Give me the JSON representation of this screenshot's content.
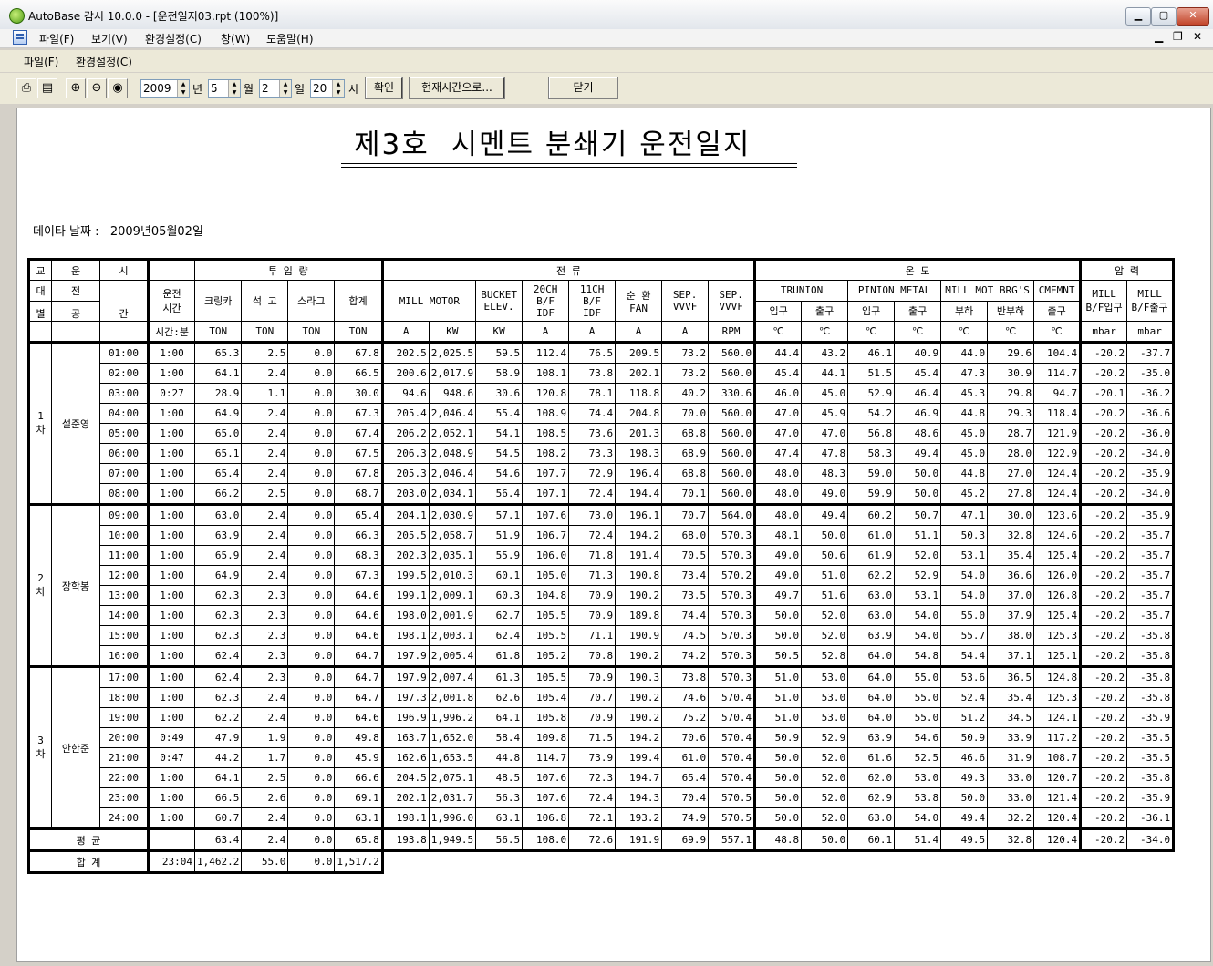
{
  "window": {
    "title": "AutoBase 감시 10.0.0 - [운전일지03.rpt (100%)]"
  },
  "menu_main": [
    "파일(F)",
    "보기(V)",
    "환경설정(C)",
    "창(W)",
    "도움말(H)"
  ],
  "menu_report": [
    "파일(F)",
    "환경설정(C)"
  ],
  "toolbar": {
    "year": "2009",
    "year_unit": "년",
    "month": "5",
    "month_unit": "월",
    "day": "2",
    "day_unit": "일",
    "hour": "20",
    "hour_unit": "시",
    "confirm": "확인",
    "current_time": "현재시간으로...",
    "close": "닫기"
  },
  "report": {
    "title": "제3호  시멘트 분쇄기 운전일지",
    "date_label": "데이타 날짜 :",
    "date_value": "2009년05월02일"
  },
  "headers": {
    "shift": [
      "교",
      "대",
      "별"
    ],
    "operator": [
      "운",
      "전",
      "공"
    ],
    "time": [
      "시",
      "간"
    ],
    "run_time": "운전\n시간",
    "input": "투 입 량",
    "current": "전 류",
    "temp": "온 도",
    "pressure": "압 력",
    "clinker": "크링카",
    "gypsum": "석 고",
    "slag": "스라그",
    "total": "합계",
    "mill_motor": "MILL MOTOR",
    "bucket": "BUCKET\nELEV.",
    "ch20": "20CH\nB/F IDF",
    "ch11": "11CH\nB/F IDF",
    "circ_fan": "순 환\nFAN",
    "sep_vvvf_a": "SEP.\nVVVF",
    "sep_vvvf_rpm": "SEP.\nVVVF",
    "trunion": "TRUNION",
    "pinion": "PINION METAL",
    "mill_brg": "MILL MOT BRG'S",
    "cmemnt": "CMEMNT",
    "mill_in": "MILL\nB/F입구",
    "mill_out": "MILL\nB/F출구",
    "sub_in": "입구",
    "sub_out": "출구",
    "sub_load": "부하",
    "sub_anti": "반부하",
    "units": [
      "시간:분",
      "TON",
      "TON",
      "TON",
      "TON",
      "A",
      "KW",
      "KW",
      "A",
      "A",
      "A",
      "A",
      "RPM",
      "℃",
      "℃",
      "℃",
      "℃",
      "℃",
      "℃",
      "℃",
      "mbar",
      "mbar"
    ]
  },
  "shifts": [
    {
      "shift": "1\n차",
      "operator": "설준영",
      "rows": [
        [
          "01:00",
          "1:00",
          "65.3",
          "2.5",
          "0.0",
          "67.8",
          "202.5",
          "2,025.5",
          "59.5",
          "112.4",
          "76.5",
          "209.5",
          "73.2",
          "560.0",
          "44.4",
          "43.2",
          "46.1",
          "40.9",
          "44.0",
          "29.6",
          "104.4",
          "-20.2",
          "-37.7"
        ],
        [
          "02:00",
          "1:00",
          "64.1",
          "2.4",
          "0.0",
          "66.5",
          "200.6",
          "2,017.9",
          "58.9",
          "108.1",
          "73.8",
          "202.1",
          "73.2",
          "560.0",
          "45.4",
          "44.1",
          "51.5",
          "45.4",
          "47.3",
          "30.9",
          "114.7",
          "-20.2",
          "-35.0"
        ],
        [
          "03:00",
          "0:27",
          "28.9",
          "1.1",
          "0.0",
          "30.0",
          "94.6",
          "948.6",
          "30.6",
          "120.8",
          "78.1",
          "118.8",
          "40.2",
          "330.6",
          "46.0",
          "45.0",
          "52.9",
          "46.4",
          "45.3",
          "29.8",
          "94.7",
          "-20.1",
          "-36.2"
        ],
        [
          "04:00",
          "1:00",
          "64.9",
          "2.4",
          "0.0",
          "67.3",
          "205.4",
          "2,046.4",
          "55.4",
          "108.9",
          "74.4",
          "204.8",
          "70.0",
          "560.0",
          "47.0",
          "45.9",
          "54.2",
          "46.9",
          "44.8",
          "29.3",
          "118.4",
          "-20.2",
          "-36.6"
        ],
        [
          "05:00",
          "1:00",
          "65.0",
          "2.4",
          "0.0",
          "67.4",
          "206.2",
          "2,052.1",
          "54.1",
          "108.5",
          "73.6",
          "201.3",
          "68.8",
          "560.0",
          "47.0",
          "47.0",
          "56.8",
          "48.6",
          "45.0",
          "28.7",
          "121.9",
          "-20.2",
          "-36.0"
        ],
        [
          "06:00",
          "1:00",
          "65.1",
          "2.4",
          "0.0",
          "67.5",
          "206.3",
          "2,048.9",
          "54.5",
          "108.2",
          "73.3",
          "198.3",
          "68.9",
          "560.0",
          "47.4",
          "47.8",
          "58.3",
          "49.4",
          "45.0",
          "28.0",
          "122.9",
          "-20.2",
          "-34.0"
        ],
        [
          "07:00",
          "1:00",
          "65.4",
          "2.4",
          "0.0",
          "67.8",
          "205.3",
          "2,046.4",
          "54.6",
          "107.7",
          "72.9",
          "196.4",
          "68.8",
          "560.0",
          "48.0",
          "48.3",
          "59.0",
          "50.0",
          "44.8",
          "27.0",
          "124.4",
          "-20.2",
          "-35.9"
        ],
        [
          "08:00",
          "1:00",
          "66.2",
          "2.5",
          "0.0",
          "68.7",
          "203.0",
          "2,034.1",
          "56.4",
          "107.1",
          "72.4",
          "194.4",
          "70.1",
          "560.0",
          "48.0",
          "49.0",
          "59.9",
          "50.0",
          "45.2",
          "27.8",
          "124.4",
          "-20.2",
          "-34.0"
        ]
      ]
    },
    {
      "shift": "2\n차",
      "operator": "장학봉",
      "rows": [
        [
          "09:00",
          "1:00",
          "63.0",
          "2.4",
          "0.0",
          "65.4",
          "204.1",
          "2,030.9",
          "57.1",
          "107.6",
          "73.0",
          "196.1",
          "70.7",
          "564.0",
          "48.0",
          "49.4",
          "60.2",
          "50.7",
          "47.1",
          "30.0",
          "123.6",
          "-20.2",
          "-35.9"
        ],
        [
          "10:00",
          "1:00",
          "63.9",
          "2.4",
          "0.0",
          "66.3",
          "205.5",
          "2,058.7",
          "51.9",
          "106.7",
          "72.4",
          "194.2",
          "68.0",
          "570.3",
          "48.1",
          "50.0",
          "61.0",
          "51.1",
          "50.3",
          "32.8",
          "124.6",
          "-20.2",
          "-35.7"
        ],
        [
          "11:00",
          "1:00",
          "65.9",
          "2.4",
          "0.0",
          "68.3",
          "202.3",
          "2,035.1",
          "55.9",
          "106.0",
          "71.8",
          "191.4",
          "70.5",
          "570.3",
          "49.0",
          "50.6",
          "61.9",
          "52.0",
          "53.1",
          "35.4",
          "125.4",
          "-20.2",
          "-35.7"
        ],
        [
          "12:00",
          "1:00",
          "64.9",
          "2.4",
          "0.0",
          "67.3",
          "199.5",
          "2,010.3",
          "60.1",
          "105.0",
          "71.3",
          "190.8",
          "73.4",
          "570.2",
          "49.0",
          "51.0",
          "62.2",
          "52.9",
          "54.0",
          "36.6",
          "126.0",
          "-20.2",
          "-35.7"
        ],
        [
          "13:00",
          "1:00",
          "62.3",
          "2.3",
          "0.0",
          "64.6",
          "199.1",
          "2,009.1",
          "60.3",
          "104.8",
          "70.9",
          "190.2",
          "73.5",
          "570.3",
          "49.7",
          "51.6",
          "63.0",
          "53.1",
          "54.0",
          "37.0",
          "126.8",
          "-20.2",
          "-35.7"
        ],
        [
          "14:00",
          "1:00",
          "62.3",
          "2.3",
          "0.0",
          "64.6",
          "198.0",
          "2,001.9",
          "62.7",
          "105.5",
          "70.9",
          "189.8",
          "74.4",
          "570.3",
          "50.0",
          "52.0",
          "63.0",
          "54.0",
          "55.0",
          "37.9",
          "125.4",
          "-20.2",
          "-35.7"
        ],
        [
          "15:00",
          "1:00",
          "62.3",
          "2.3",
          "0.0",
          "64.6",
          "198.1",
          "2,003.1",
          "62.4",
          "105.5",
          "71.1",
          "190.9",
          "74.5",
          "570.3",
          "50.0",
          "52.0",
          "63.9",
          "54.0",
          "55.7",
          "38.0",
          "125.3",
          "-20.2",
          "-35.8"
        ],
        [
          "16:00",
          "1:00",
          "62.4",
          "2.3",
          "0.0",
          "64.7",
          "197.9",
          "2,005.4",
          "61.8",
          "105.2",
          "70.8",
          "190.2",
          "74.2",
          "570.3",
          "50.5",
          "52.8",
          "64.0",
          "54.8",
          "54.4",
          "37.1",
          "125.1",
          "-20.2",
          "-35.8"
        ]
      ]
    },
    {
      "shift": "3\n차",
      "operator": "안한준",
      "rows": [
        [
          "17:00",
          "1:00",
          "62.4",
          "2.3",
          "0.0",
          "64.7",
          "197.9",
          "2,007.4",
          "61.3",
          "105.5",
          "70.9",
          "190.3",
          "73.8",
          "570.3",
          "51.0",
          "53.0",
          "64.0",
          "55.0",
          "53.6",
          "36.5",
          "124.8",
          "-20.2",
          "-35.8"
        ],
        [
          "18:00",
          "1:00",
          "62.3",
          "2.4",
          "0.0",
          "64.7",
          "197.3",
          "2,001.8",
          "62.6",
          "105.4",
          "70.7",
          "190.2",
          "74.6",
          "570.4",
          "51.0",
          "53.0",
          "64.0",
          "55.0",
          "52.4",
          "35.4",
          "125.3",
          "-20.2",
          "-35.8"
        ],
        [
          "19:00",
          "1:00",
          "62.2",
          "2.4",
          "0.0",
          "64.6",
          "196.9",
          "1,996.2",
          "64.1",
          "105.8",
          "70.9",
          "190.2",
          "75.2",
          "570.4",
          "51.0",
          "53.0",
          "64.0",
          "55.0",
          "51.2",
          "34.5",
          "124.1",
          "-20.2",
          "-35.9"
        ],
        [
          "20:00",
          "0:49",
          "47.9",
          "1.9",
          "0.0",
          "49.8",
          "163.7",
          "1,652.0",
          "58.4",
          "109.8",
          "71.5",
          "194.2",
          "70.6",
          "570.4",
          "50.9",
          "52.9",
          "63.9",
          "54.6",
          "50.9",
          "33.9",
          "117.2",
          "-20.2",
          "-35.5"
        ],
        [
          "21:00",
          "0:47",
          "44.2",
          "1.7",
          "0.0",
          "45.9",
          "162.6",
          "1,653.5",
          "44.8",
          "114.7",
          "73.9",
          "199.4",
          "61.0",
          "570.4",
          "50.0",
          "52.0",
          "61.6",
          "52.5",
          "46.6",
          "31.9",
          "108.7",
          "-20.2",
          "-35.5"
        ],
        [
          "22:00",
          "1:00",
          "64.1",
          "2.5",
          "0.0",
          "66.6",
          "204.5",
          "2,075.1",
          "48.5",
          "107.6",
          "72.3",
          "194.7",
          "65.4",
          "570.4",
          "50.0",
          "52.0",
          "62.0",
          "53.0",
          "49.3",
          "33.0",
          "120.7",
          "-20.2",
          "-35.8"
        ],
        [
          "23:00",
          "1:00",
          "66.5",
          "2.6",
          "0.0",
          "69.1",
          "202.1",
          "2,031.7",
          "56.3",
          "107.6",
          "72.4",
          "194.3",
          "70.4",
          "570.5",
          "50.0",
          "52.0",
          "62.9",
          "53.8",
          "50.0",
          "33.0",
          "121.4",
          "-20.2",
          "-35.9"
        ],
        [
          "24:00",
          "1:00",
          "60.7",
          "2.4",
          "0.0",
          "63.1",
          "198.1",
          "1,996.0",
          "63.1",
          "106.8",
          "72.1",
          "193.2",
          "74.9",
          "570.5",
          "50.0",
          "52.0",
          "63.0",
          "54.0",
          "49.4",
          "32.2",
          "120.4",
          "-20.2",
          "-36.1"
        ]
      ]
    }
  ],
  "average": {
    "label": "평 균",
    "values": [
      "",
      "63.4",
      "2.4",
      "0.0",
      "65.8",
      "193.8",
      "1,949.5",
      "56.5",
      "108.0",
      "72.6",
      "191.9",
      "69.9",
      "557.1",
      "48.8",
      "50.0",
      "60.1",
      "51.4",
      "49.5",
      "32.8",
      "120.4",
      "-20.2",
      "-34.0"
    ]
  },
  "total": {
    "label": "합 계",
    "values": [
      "23:04",
      "1,462.2",
      "55.0",
      "0.0",
      "1,517.2"
    ]
  }
}
